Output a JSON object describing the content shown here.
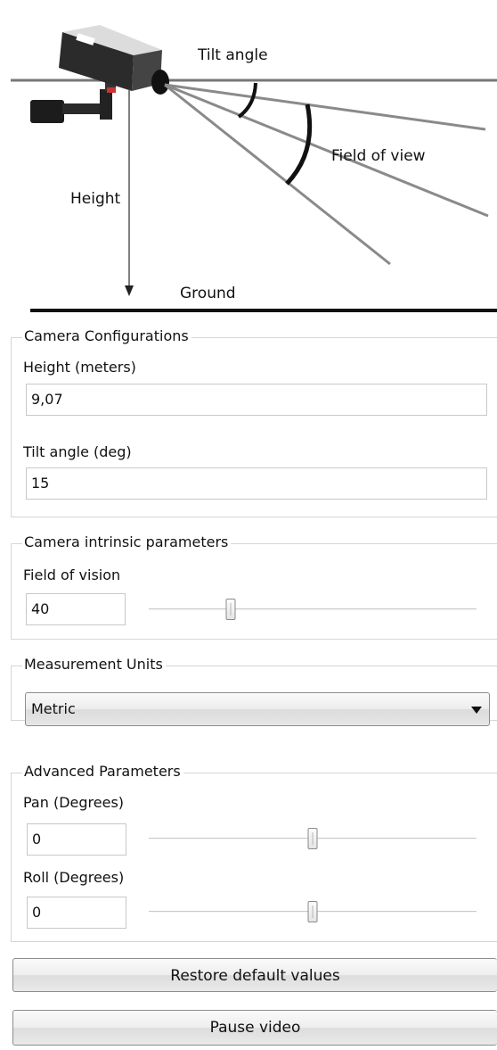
{
  "diagram": {
    "tilt_angle_label": "Tilt angle",
    "field_of_view_label": "Field of view",
    "height_label": "Height",
    "ground_label": "Ground"
  },
  "camera_config": {
    "title": "Camera Configurations",
    "height_label": "Height (meters)",
    "height_value": "9,07",
    "tilt_label": "Tilt angle (deg)",
    "tilt_value": "15"
  },
  "intrinsic": {
    "title": "Camera intrinsic parameters",
    "fov_label": "Field of vision",
    "fov_value": "40",
    "fov_slider_fraction": 0.25
  },
  "units": {
    "title": "Measurement Units",
    "selected": "Metric"
  },
  "advanced": {
    "title": "Advanced Parameters",
    "pan_label": "Pan (Degrees)",
    "pan_value": "0",
    "pan_slider_fraction": 0.5,
    "roll_label": "Roll (Degrees)",
    "roll_value": "0",
    "roll_slider_fraction": 0.5
  },
  "buttons": {
    "restore_label": "Restore default values",
    "pause_label": "Pause video"
  }
}
